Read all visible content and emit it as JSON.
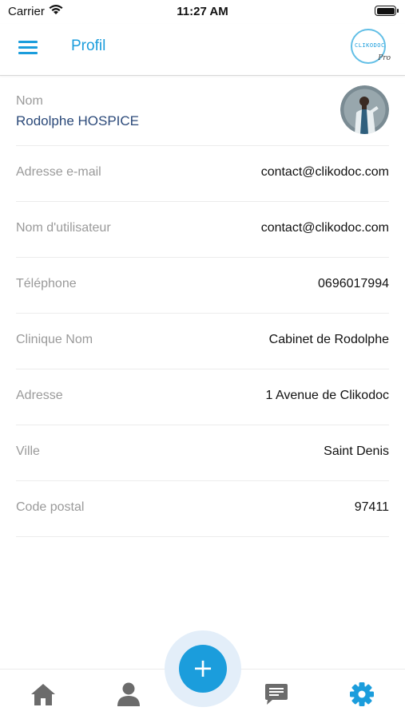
{
  "status_bar": {
    "carrier": "Carrier",
    "time": "11:27 AM",
    "wifi_icon": "wifi-icon",
    "battery_icon": "battery-icon"
  },
  "header": {
    "title": "Profil",
    "menu_icon": "hamburger-menu-icon",
    "logo_text": "CLIKODOC",
    "logo_sub": "Pro"
  },
  "profile": {
    "name_label": "Nom",
    "name_value": "Rodolphe HOSPICE",
    "avatar_icon": "doctor-avatar",
    "fields": [
      {
        "label": "Adresse e-mail",
        "value": "contact@clikodoc.com"
      },
      {
        "label": "Nom d'utilisateur",
        "value": "contact@clikodoc.com"
      },
      {
        "label": "Téléphone",
        "value": "0696017994"
      },
      {
        "label": "Clinique Nom",
        "value": "Cabinet de Rodolphe"
      },
      {
        "label": "Adresse",
        "value": "1 Avenue de Clikodoc"
      },
      {
        "label": "Ville",
        "value": "Saint Denis"
      },
      {
        "label": "Code postal",
        "value": "97411"
      }
    ]
  },
  "tabbar": {
    "tabs": [
      {
        "icon": "home-icon",
        "active": false
      },
      {
        "icon": "user-icon",
        "active": false
      },
      {
        "icon": "chat-icon",
        "active": false
      },
      {
        "icon": "gear-icon",
        "active": true
      }
    ],
    "fab_icon": "plus-icon",
    "fab_label": "+"
  },
  "colors": {
    "accent": "#1b9ddc",
    "inactive_icon": "#6b6b6b",
    "label": "#9a9a9a",
    "name": "#2c4a7a"
  }
}
